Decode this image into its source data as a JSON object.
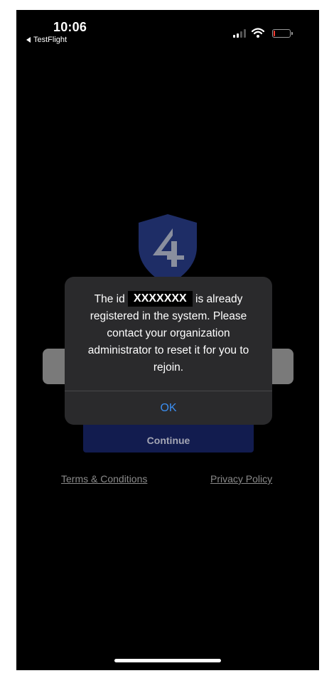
{
  "status_bar": {
    "time": "10:06",
    "back_app": "TestFlight",
    "battery_level": 0.1
  },
  "login": {
    "continue_label": "Continue",
    "terms_label": "Terms & Conditions",
    "privacy_label": "Privacy Policy"
  },
  "alert": {
    "message_prefix": "The id",
    "redacted_id": "XXXXXXX",
    "message_suffix": "is already registered in the system. Please contact your organization administrator to reset it for you to rejoin.",
    "ok_label": "OK"
  },
  "colors": {
    "background": "#000000",
    "alert_background": "#2a2a2c",
    "accent_blue": "#3b8ef0",
    "continue_button": "#121c4f",
    "battery_low": "#ff3b30"
  },
  "icons": {
    "signal": "cellular-signal-icon",
    "wifi": "wifi-icon",
    "battery": "battery-icon",
    "logo": "shield-4-logo-icon"
  }
}
